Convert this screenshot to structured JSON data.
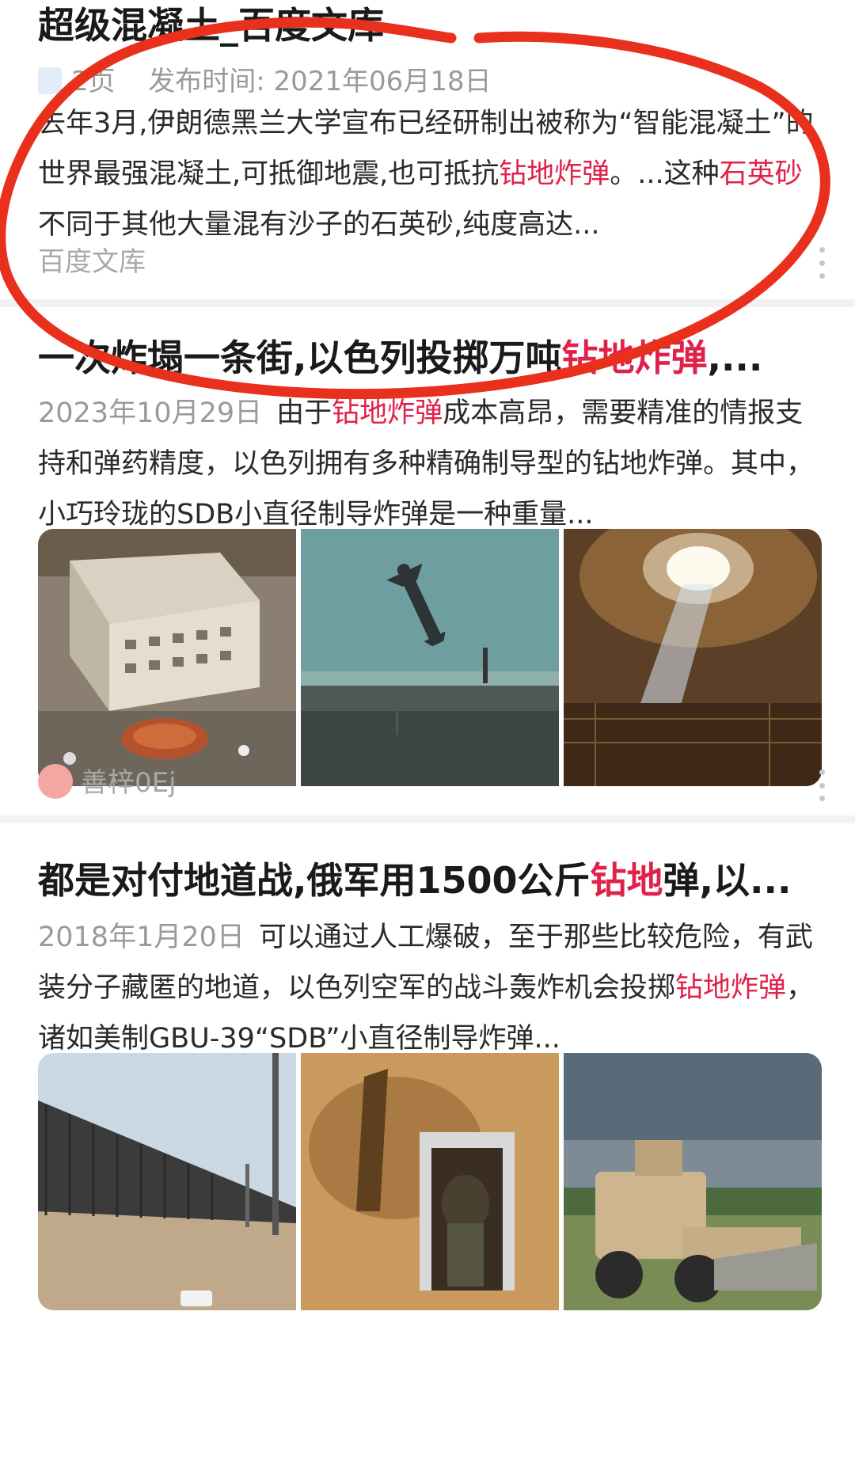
{
  "results": [
    {
      "title": "超级混凝土_百度文库",
      "pages": "2页",
      "publish_label": "发布时间: 2021年06月18日",
      "snippet": [
        {
          "t": "去年3月,伊朗德黑兰大学宣布已经研制出被称为“智能混凝土”的世界最强混凝土,可抵御地震,也可抵抗",
          "hl": false
        },
        {
          "t": "钻地炸弹",
          "hl": true
        },
        {
          "t": "。...这种",
          "hl": false
        },
        {
          "t": "石英砂",
          "hl": true
        },
        {
          "t": "不同于其他大量混有沙子的石英砂,纯度高达...",
          "hl": false
        }
      ],
      "source": "百度文库"
    },
    {
      "title_parts": [
        {
          "t": "一次炸塌一条街,以色列投掷万吨",
          "hl": false
        },
        {
          "t": "钻地炸弹",
          "hl": true
        },
        {
          "t": ",...",
          "hl": false
        }
      ],
      "date": "2023年10月29日",
      "snippet": [
        {
          "t": "由于",
          "hl": false
        },
        {
          "t": "钻地炸弹",
          "hl": true
        },
        {
          "t": "成本高昂，需要精准的情报支持和弹药精度，以色列拥有多种精确制导型的钻地炸弹。其中，小巧玲珑的SDB小直径制导炸弹是一种重量...",
          "hl": false
        }
      ],
      "author": "善梓0Ej",
      "images": [
        "aerial-buildings",
        "falling-bomb",
        "bunker-ceiling-hole"
      ]
    },
    {
      "title_parts": [
        {
          "t": "都是对付地道战,俄军用1500公斤",
          "hl": false
        },
        {
          "t": "钻地",
          "hl": true
        },
        {
          "t": "弹,以...",
          "hl": false
        }
      ],
      "date": "2018年1月20日",
      "snippet": [
        {
          "t": "可以通过人工爆破，至于那些比较危险，有武装分子藏匿的地道，以色列空军的战斗轰炸机会投掷",
          "hl": false
        },
        {
          "t": "钻地炸弹",
          "hl": true
        },
        {
          "t": "，诸如美制GBU-39“SDB”小直径制导炸弹...",
          "hl": false
        }
      ],
      "images": [
        "border-wall",
        "tunnel-soldier",
        "military-vehicle"
      ]
    }
  ],
  "colors": {
    "highlight": "#e0224a",
    "annotation": "#e8301c",
    "meta": "#9a9a9a"
  }
}
